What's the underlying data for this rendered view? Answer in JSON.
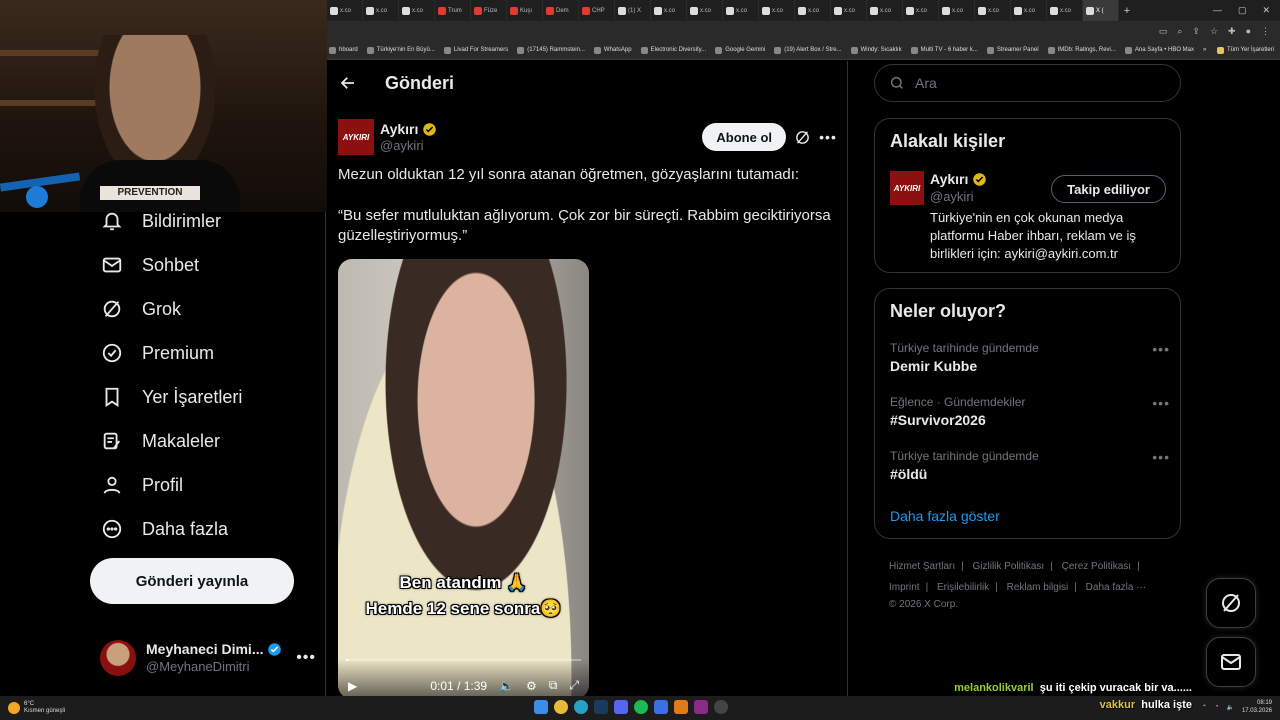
{
  "browser": {
    "tabs": [
      {
        "label": "x.co",
        "red": false
      },
      {
        "label": "x.co",
        "red": false
      },
      {
        "label": "x.co",
        "red": false
      },
      {
        "label": "Trum",
        "red": true
      },
      {
        "label": "Fûze",
        "red": true
      },
      {
        "label": "Kuşı",
        "red": true
      },
      {
        "label": "Dem",
        "red": true
      },
      {
        "label": "CHP",
        "red": true
      },
      {
        "label": "(1) X",
        "red": false
      },
      {
        "label": "x.co",
        "red": false
      },
      {
        "label": "x.co",
        "red": false
      },
      {
        "label": "x.co",
        "red": false
      },
      {
        "label": "x.co",
        "red": false
      },
      {
        "label": "x.co",
        "red": false
      },
      {
        "label": "x.co",
        "red": false
      },
      {
        "label": "x.co",
        "red": false
      },
      {
        "label": "x.co",
        "red": false
      },
      {
        "label": "x.co",
        "red": false
      },
      {
        "label": "x.co",
        "red": false
      },
      {
        "label": "x.co",
        "red": false
      },
      {
        "label": "x.co",
        "red": false
      },
      {
        "label": "X (",
        "red": false
      }
    ],
    "bookmarks": [
      "hboard",
      "Türkiye'nin En Büyü...",
      "Livad For Streamers",
      "(17145) Rammstein...",
      "WhatsApp",
      "Electronic Diversity...",
      "Google Gemini",
      "(19) Alert Box / Stre...",
      "Windy: Sıcaklık",
      "Multi TV - 6 haber k...",
      "Streamer Panel",
      "IMDb: Ratings, Revi...",
      "Ana Sayfa • HBO Max"
    ],
    "bookmarks_more": "»",
    "all_bookmarks": "Tüm Yer İşaretleri"
  },
  "nav": {
    "items": [
      {
        "label": "Bildirimler",
        "icon": "bell-icon"
      },
      {
        "label": "Sohbet",
        "icon": "envelope-icon"
      },
      {
        "label": "Grok",
        "icon": "grok-icon"
      },
      {
        "label": "Premium",
        "icon": "verified-badge-icon"
      },
      {
        "label": "Yer İşaretleri",
        "icon": "bookmark-icon"
      },
      {
        "label": "Makaleler",
        "icon": "article-icon"
      },
      {
        "label": "Profil",
        "icon": "person-icon"
      },
      {
        "label": "Daha fazla",
        "icon": "more-circle-icon"
      }
    ],
    "post_button": "Gönderi yayınla",
    "account": {
      "display_name": "Meyhaneci Dimi...",
      "handle": "@MeyhaneDimitri",
      "more": "•••"
    }
  },
  "main": {
    "header_title": "Gönderi",
    "tweet": {
      "logo_text": "AYKIRI",
      "display_name": "Aykırı",
      "handle": "@aykiri",
      "subscribe_label": "Abone ol",
      "text_1": "Mezun olduktan 12 yıl sonra atanan öğretmen, gözyaşlarını tutamadı:",
      "text_2": "“Bu sefer mutluluktan ağlıyorum. Çok zor bir süreçti. Rabbim geciktiriyorsa güzelleştiriyormuş.”",
      "video": {
        "caption_1": "Ben atandım 🙏",
        "caption_2": "Hemde 12 sene sonra🥺",
        "time": "0:01 / 1:39",
        "progress": 0.01
      }
    }
  },
  "right": {
    "search_placeholder": "Ara",
    "related": {
      "title": "Alakalı kişiler",
      "display_name": "Aykırı",
      "handle": "@aykiri",
      "bio": "Türkiye'nin en çok okunan medya platformu Haber ihbarı, reklam ve iş birlikleri için: aykiri@aykiri.com.tr",
      "follow_label": "Takip ediliyor",
      "logo_text": "AYKIRI"
    },
    "trends": {
      "title": "Neler oluyor?",
      "items": [
        {
          "meta": "Türkiye tarihinde gündemde",
          "name": "Demir Kubbe"
        },
        {
          "meta": "Eğlence · Gündemdekiler",
          "name": "#Survivor2026"
        },
        {
          "meta": "Türkiye tarihinde gündemde",
          "name": "#öldü"
        }
      ],
      "show_more": "Daha fazla göster"
    },
    "footer": {
      "row1": [
        "Hizmet Şartları",
        "Gizlilik Politikası",
        "Çerez Politikası"
      ],
      "row2": [
        "Imprint",
        "Erişilebilirlik",
        "Reklam bilgisi",
        "Daha fazla ···"
      ],
      "copyright": "© 2026 X Corp."
    }
  },
  "chat": [
    {
      "user": "melankolikvaril",
      "message": "şu iti çekip vuracak bir va......"
    },
    {
      "user": "vakkur",
      "message": "hulka işte"
    }
  ],
  "webcam": {
    "shirt_text": "PREVENTION"
  },
  "taskbar": {
    "weather_temp": "6°C",
    "weather_desc": "Kısmen güneşli",
    "time": "08:19",
    "date": "17.03.2026"
  },
  "colors": {
    "accent": "#1d9bf0",
    "verified_gold": "#e2b719",
    "brand_red": "#8b1111"
  }
}
